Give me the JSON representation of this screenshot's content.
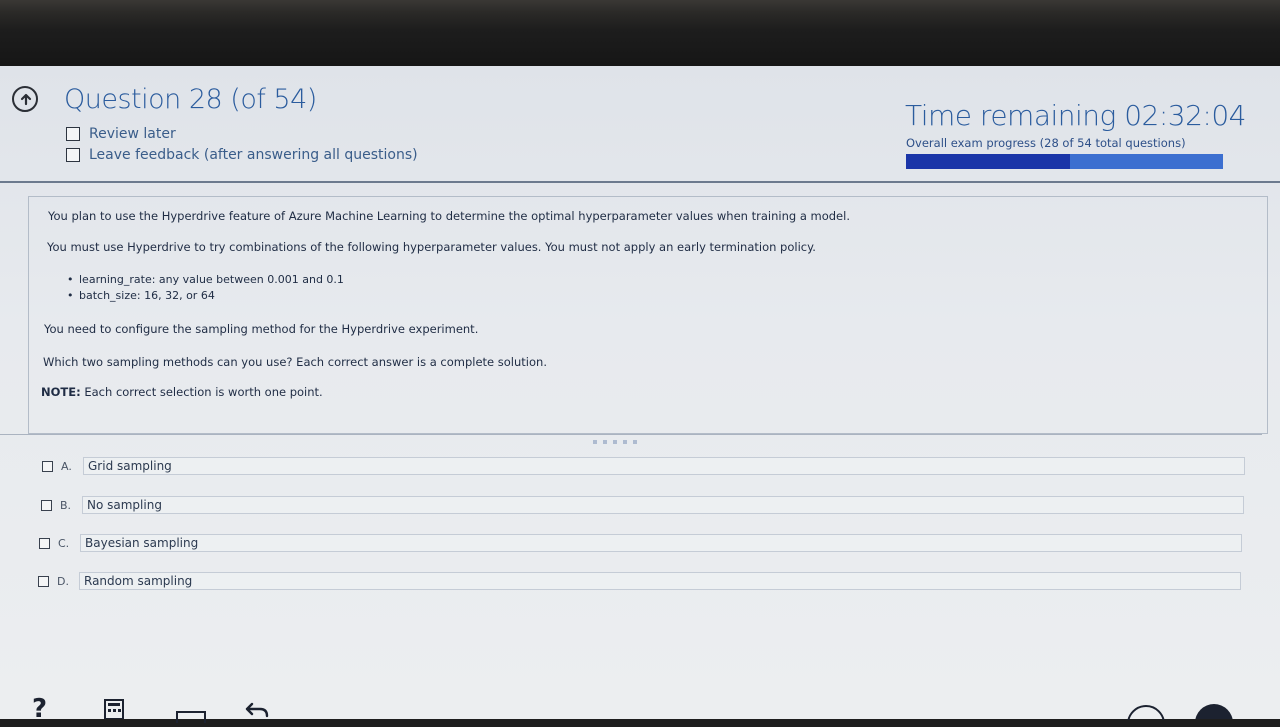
{
  "header": {
    "question_title": "Question 28 (of 54)",
    "review_later": "Review later",
    "leave_feedback": "Leave feedback (after answering all questions)",
    "time_remaining": "Time remaining 02:32:04",
    "progress_label": "Overall exam progress (28 of 54 total questions)",
    "progress_fraction": 0.5185
  },
  "question": {
    "line1": "You plan to use the Hyperdrive feature of Azure Machine Learning to determine the optimal hyperparameter values when training a model.",
    "line2": "You must use Hyperdrive to try combinations of the following hyperparameter values. You must not apply an early termination policy.",
    "bullets": [
      "learning_rate: any value between 0.001 and 0.1",
      "batch_size: 16, 32, or 64"
    ],
    "line3": "You need to configure the sampling method for the Hyperdrive experiment.",
    "line4": "Which two sampling methods can you use? Each correct answer is a complete solution.",
    "note_label": "NOTE:",
    "note_text": " Each correct selection is worth one point."
  },
  "options": [
    {
      "letter": "A.",
      "text": "Grid sampling"
    },
    {
      "letter": "B.",
      "text": "No sampling"
    },
    {
      "letter": "C.",
      "text": "Bayesian sampling"
    },
    {
      "letter": "D.",
      "text": "Random sampling"
    }
  ],
  "toolbar": {
    "help_glyph": "?"
  },
  "colors": {
    "accent": "#2b5c9e",
    "progress_fill": "#1a35a8",
    "progress_track": "#3c6fd0"
  }
}
